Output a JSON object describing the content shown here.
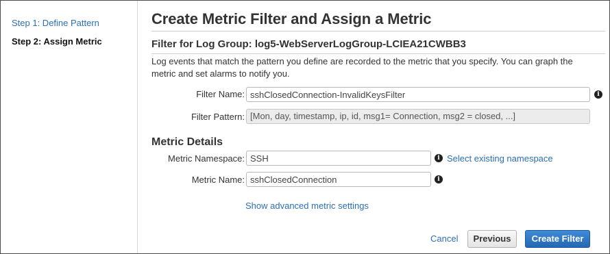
{
  "sidebar": {
    "steps": [
      {
        "label": "Step 1: Define Pattern"
      },
      {
        "label": "Step 2: Assign Metric"
      }
    ]
  },
  "main": {
    "title": "Create Metric Filter and Assign a Metric",
    "subtitle": "Filter for Log Group: log5-WebServerLogGroup-LCIEA21CWBB3",
    "description": "Log events that match the pattern you define are recorded to the metric that you specify. You can graph the metric and set alarms to notify you.",
    "filter_name": {
      "label": "Filter Name:",
      "value": "sshClosedConnection-InvalidKeysFilter"
    },
    "filter_pattern": {
      "label": "Filter Pattern:",
      "value": "[Mon, day, timestamp, ip, id, msg1= Connection, msg2 = closed, ...]"
    },
    "metric_details": {
      "title": "Metric Details",
      "namespace": {
        "label": "Metric Namespace:",
        "value": "SSH",
        "link": "Select existing namespace"
      },
      "metric_name": {
        "label": "Metric Name:",
        "value": "sshClosedConnection"
      },
      "advanced_link": "Show advanced metric settings"
    },
    "actions": {
      "cancel": "Cancel",
      "previous": "Previous",
      "create": "Create Filter"
    }
  },
  "icons": {
    "info": "info-icon",
    "info_glyph": "i"
  },
  "colors": {
    "link": "#2b6fb5",
    "primary_button": "#2567b3"
  }
}
